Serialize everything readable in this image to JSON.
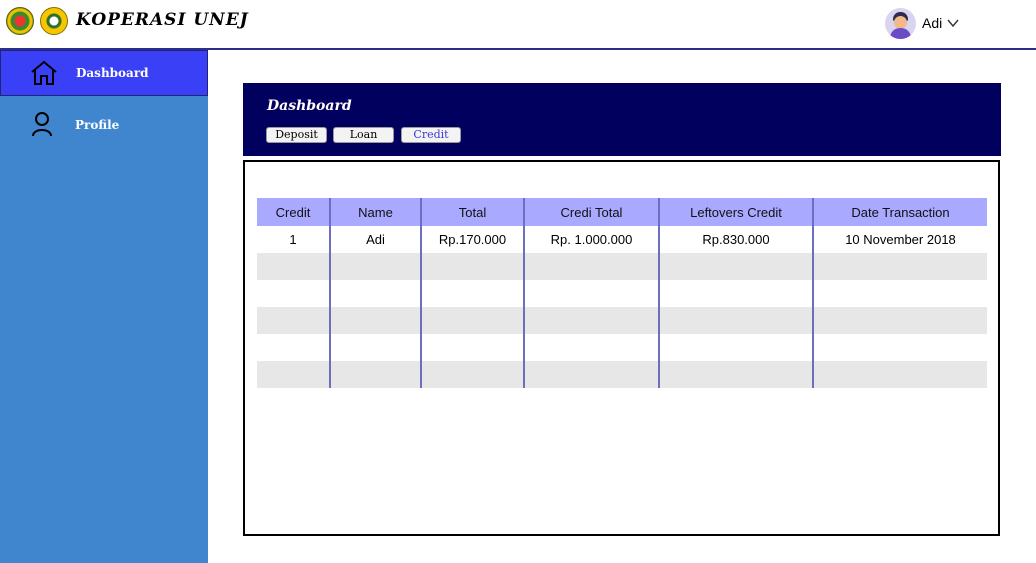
{
  "header": {
    "brand": "KOPERASI UNEJ",
    "user_name": "Adi"
  },
  "sidebar": {
    "items": [
      {
        "label": "Dashboard",
        "icon": "home-icon",
        "active": true
      },
      {
        "label": "Profile",
        "icon": "user-icon",
        "active": false
      }
    ]
  },
  "panel": {
    "title": "Dashboard",
    "tabs": [
      {
        "label": "Deposit"
      },
      {
        "label": "Loan"
      },
      {
        "label": "Credit"
      }
    ]
  },
  "table": {
    "columns": [
      "Credit",
      "Name",
      "Total",
      "Credi Total",
      "Leftovers Credit",
      "Date Transaction"
    ],
    "rows": [
      [
        "1",
        "Adi",
        "Rp.170.000",
        "Rp. 1.000.000",
        "Rp.830.000",
        "10 November 2018"
      ],
      [
        "",
        "",
        "",
        "",
        "",
        ""
      ],
      [
        "",
        "",
        "",
        "",
        "",
        ""
      ],
      [
        "",
        "",
        "",
        "",
        "",
        ""
      ],
      [
        "",
        "",
        "",
        "",
        "",
        ""
      ],
      [
        "",
        "",
        "",
        "",
        "",
        ""
      ]
    ]
  },
  "colors": {
    "header_border": "#2b2f8a",
    "sidebar_bg": "#3f86cf",
    "sidebar_active": "#3a40f5",
    "panel_head": "#02005f",
    "table_header": "#a9a9ff"
  }
}
